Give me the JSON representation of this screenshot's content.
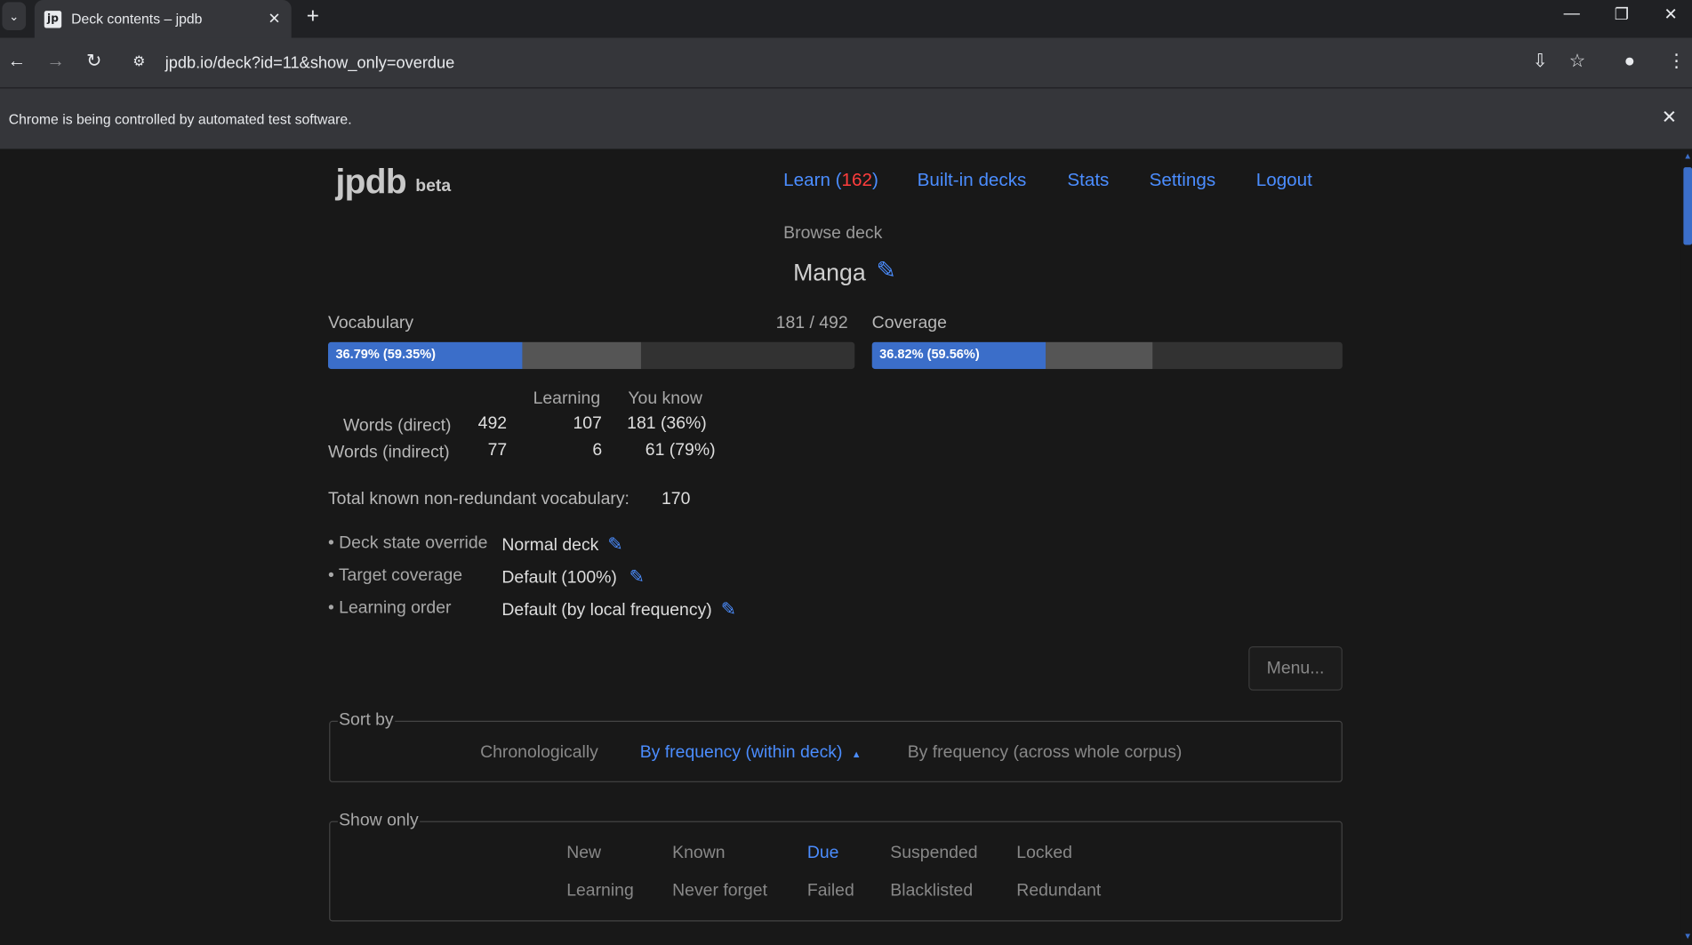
{
  "browser": {
    "tab_title": "Deck contents – jpdb",
    "favicon_text": "jp",
    "url": "jpdb.io/deck?id=11&show_only=overdue",
    "infobar_text": "Chrome is being controlled by automated test software."
  },
  "site": {
    "logo": "jpdb",
    "logo_sub": "beta",
    "nav": {
      "learn_label": "Learn (",
      "learn_count": "162",
      "learn_close": ")",
      "builtin": "Built-in decks",
      "stats": "Stats",
      "settings": "Settings",
      "logout": "Logout"
    }
  },
  "deck": {
    "browse_label": "Browse deck",
    "name": "Manga",
    "vocabulary_label": "Vocabulary",
    "vocabulary_count": "181 / 492",
    "coverage_label": "Coverage",
    "vocab_bar": {
      "text": "36.79% (59.35%)",
      "known_pct": 36.79,
      "learning_pct": 59.35
    },
    "coverage_bar": {
      "text": "36.82% (59.56%)",
      "known_pct": 36.82,
      "learning_pct": 59.56
    },
    "stats": {
      "header_learning": "Learning",
      "header_known": "You know",
      "rows": [
        {
          "label": "Words (direct)",
          "total": "492",
          "learning": "107",
          "known": "181 (36%)"
        },
        {
          "label": "Words (indirect)",
          "total": "77",
          "learning": "6",
          "known": "61 (79%)"
        }
      ]
    },
    "total_known_label": "Total known non-redundant vocabulary:",
    "total_known_value": "170",
    "settings": [
      {
        "label": "Deck state override",
        "value": "Normal deck"
      },
      {
        "label": "Target coverage",
        "value": "Default (100%)"
      },
      {
        "label": "Learning order",
        "value": "Default (by local frequency)"
      }
    ],
    "menu_button": "Menu..."
  },
  "sort": {
    "legend": "Sort by",
    "options": [
      "Chronologically",
      "By frequency (within deck)",
      "By frequency (across whole corpus)"
    ],
    "active": "By frequency (within deck)",
    "active_arrow": "▲"
  },
  "show_only": {
    "legend": "Show only",
    "row1": [
      "New",
      "Known",
      "Due",
      "Suspended",
      "Locked"
    ],
    "row2": [
      "Learning",
      "Never forget",
      "Failed",
      "Blacklisted",
      "Redundant"
    ],
    "active": "Due"
  },
  "colors": {
    "accent": "#4b8dff",
    "bar_known": "#3b6ec9",
    "learn_count": "#ff3d3d"
  }
}
